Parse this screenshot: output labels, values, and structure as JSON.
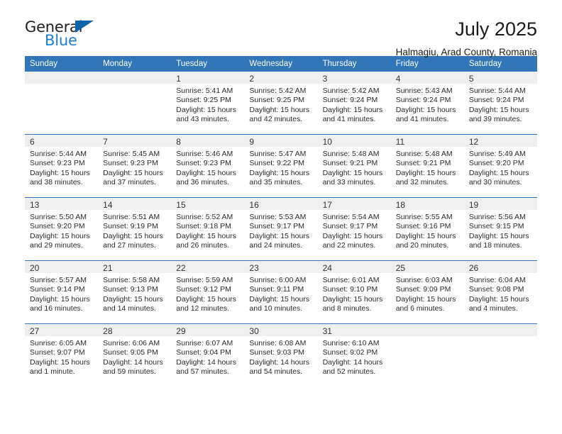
{
  "brand": {
    "name_part1": "General",
    "name_part2": "Blue",
    "triangle_color": "#0b63a8",
    "blue_color": "#1a7fd4"
  },
  "header": {
    "title": "July 2025",
    "subtitle": "Halmagiu, Arad County, Romania"
  },
  "theme": {
    "header_blue": "#3275b8",
    "daynum_bg": "#efefef",
    "text": "#2b2b2b"
  },
  "weekday_headers": [
    "Sunday",
    "Monday",
    "Tuesday",
    "Wednesday",
    "Thursday",
    "Friday",
    "Saturday"
  ],
  "labels": {
    "sunrise": "Sunrise:",
    "sunset": "Sunset:",
    "daylight": "Daylight:"
  },
  "weeks": [
    [
      {
        "day": "",
        "sunrise": "",
        "sunset": "",
        "daylight": ""
      },
      {
        "day": "",
        "sunrise": "",
        "sunset": "",
        "daylight": ""
      },
      {
        "day": "1",
        "sunrise": "Sunrise: 5:41 AM",
        "sunset": "Sunset: 9:25 PM",
        "daylight": "Daylight: 15 hours and 43 minutes."
      },
      {
        "day": "2",
        "sunrise": "Sunrise: 5:42 AM",
        "sunset": "Sunset: 9:25 PM",
        "daylight": "Daylight: 15 hours and 42 minutes."
      },
      {
        "day": "3",
        "sunrise": "Sunrise: 5:42 AM",
        "sunset": "Sunset: 9:24 PM",
        "daylight": "Daylight: 15 hours and 41 minutes."
      },
      {
        "day": "4",
        "sunrise": "Sunrise: 5:43 AM",
        "sunset": "Sunset: 9:24 PM",
        "daylight": "Daylight: 15 hours and 41 minutes."
      },
      {
        "day": "5",
        "sunrise": "Sunrise: 5:44 AM",
        "sunset": "Sunset: 9:24 PM",
        "daylight": "Daylight: 15 hours and 39 minutes."
      }
    ],
    [
      {
        "day": "6",
        "sunrise": "Sunrise: 5:44 AM",
        "sunset": "Sunset: 9:23 PM",
        "daylight": "Daylight: 15 hours and 38 minutes."
      },
      {
        "day": "7",
        "sunrise": "Sunrise: 5:45 AM",
        "sunset": "Sunset: 9:23 PM",
        "daylight": "Daylight: 15 hours and 37 minutes."
      },
      {
        "day": "8",
        "sunrise": "Sunrise: 5:46 AM",
        "sunset": "Sunset: 9:23 PM",
        "daylight": "Daylight: 15 hours and 36 minutes."
      },
      {
        "day": "9",
        "sunrise": "Sunrise: 5:47 AM",
        "sunset": "Sunset: 9:22 PM",
        "daylight": "Daylight: 15 hours and 35 minutes."
      },
      {
        "day": "10",
        "sunrise": "Sunrise: 5:48 AM",
        "sunset": "Sunset: 9:21 PM",
        "daylight": "Daylight: 15 hours and 33 minutes."
      },
      {
        "day": "11",
        "sunrise": "Sunrise: 5:48 AM",
        "sunset": "Sunset: 9:21 PM",
        "daylight": "Daylight: 15 hours and 32 minutes."
      },
      {
        "day": "12",
        "sunrise": "Sunrise: 5:49 AM",
        "sunset": "Sunset: 9:20 PM",
        "daylight": "Daylight: 15 hours and 30 minutes."
      }
    ],
    [
      {
        "day": "13",
        "sunrise": "Sunrise: 5:50 AM",
        "sunset": "Sunset: 9:20 PM",
        "daylight": "Daylight: 15 hours and 29 minutes."
      },
      {
        "day": "14",
        "sunrise": "Sunrise: 5:51 AM",
        "sunset": "Sunset: 9:19 PM",
        "daylight": "Daylight: 15 hours and 27 minutes."
      },
      {
        "day": "15",
        "sunrise": "Sunrise: 5:52 AM",
        "sunset": "Sunset: 9:18 PM",
        "daylight": "Daylight: 15 hours and 26 minutes."
      },
      {
        "day": "16",
        "sunrise": "Sunrise: 5:53 AM",
        "sunset": "Sunset: 9:17 PM",
        "daylight": "Daylight: 15 hours and 24 minutes."
      },
      {
        "day": "17",
        "sunrise": "Sunrise: 5:54 AM",
        "sunset": "Sunset: 9:17 PM",
        "daylight": "Daylight: 15 hours and 22 minutes."
      },
      {
        "day": "18",
        "sunrise": "Sunrise: 5:55 AM",
        "sunset": "Sunset: 9:16 PM",
        "daylight": "Daylight: 15 hours and 20 minutes."
      },
      {
        "day": "19",
        "sunrise": "Sunrise: 5:56 AM",
        "sunset": "Sunset: 9:15 PM",
        "daylight": "Daylight: 15 hours and 18 minutes."
      }
    ],
    [
      {
        "day": "20",
        "sunrise": "Sunrise: 5:57 AM",
        "sunset": "Sunset: 9:14 PM",
        "daylight": "Daylight: 15 hours and 16 minutes."
      },
      {
        "day": "21",
        "sunrise": "Sunrise: 5:58 AM",
        "sunset": "Sunset: 9:13 PM",
        "daylight": "Daylight: 15 hours and 14 minutes."
      },
      {
        "day": "22",
        "sunrise": "Sunrise: 5:59 AM",
        "sunset": "Sunset: 9:12 PM",
        "daylight": "Daylight: 15 hours and 12 minutes."
      },
      {
        "day": "23",
        "sunrise": "Sunrise: 6:00 AM",
        "sunset": "Sunset: 9:11 PM",
        "daylight": "Daylight: 15 hours and 10 minutes."
      },
      {
        "day": "24",
        "sunrise": "Sunrise: 6:01 AM",
        "sunset": "Sunset: 9:10 PM",
        "daylight": "Daylight: 15 hours and 8 minutes."
      },
      {
        "day": "25",
        "sunrise": "Sunrise: 6:03 AM",
        "sunset": "Sunset: 9:09 PM",
        "daylight": "Daylight: 15 hours and 6 minutes."
      },
      {
        "day": "26",
        "sunrise": "Sunrise: 6:04 AM",
        "sunset": "Sunset: 9:08 PM",
        "daylight": "Daylight: 15 hours and 4 minutes."
      }
    ],
    [
      {
        "day": "27",
        "sunrise": "Sunrise: 6:05 AM",
        "sunset": "Sunset: 9:07 PM",
        "daylight": "Daylight: 15 hours and 1 minute."
      },
      {
        "day": "28",
        "sunrise": "Sunrise: 6:06 AM",
        "sunset": "Sunset: 9:05 PM",
        "daylight": "Daylight: 14 hours and 59 minutes."
      },
      {
        "day": "29",
        "sunrise": "Sunrise: 6:07 AM",
        "sunset": "Sunset: 9:04 PM",
        "daylight": "Daylight: 14 hours and 57 minutes."
      },
      {
        "day": "30",
        "sunrise": "Sunrise: 6:08 AM",
        "sunset": "Sunset: 9:03 PM",
        "daylight": "Daylight: 14 hours and 54 minutes."
      },
      {
        "day": "31",
        "sunrise": "Sunrise: 6:10 AM",
        "sunset": "Sunset: 9:02 PM",
        "daylight": "Daylight: 14 hours and 52 minutes."
      },
      {
        "day": "",
        "sunrise": "",
        "sunset": "",
        "daylight": ""
      },
      {
        "day": "",
        "sunrise": "",
        "sunset": "",
        "daylight": ""
      }
    ]
  ]
}
